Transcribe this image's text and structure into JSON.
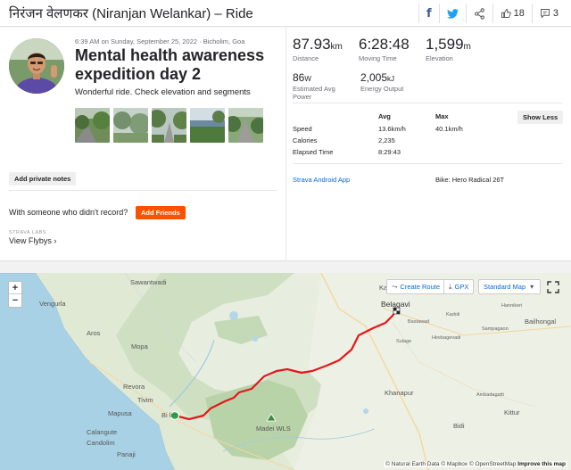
{
  "header": {
    "title": "निरंजन वेलणकर (Niranjan Welankar) – Ride",
    "kudos_count": "18",
    "comments_count": "3"
  },
  "activity": {
    "meta": "6:39 AM on Sunday, September 25, 2022 · Bicholim, Goa",
    "title": "Mental health awareness expedition day 2",
    "description": "Wonderful ride. Check elevation and segments",
    "add_notes_label": "Add private notes",
    "someone_text": "With someone who didn't record?",
    "add_friends_label": "Add Friends",
    "labs_label": "STRAVA LABS",
    "flyby_label": "View Flybys ›"
  },
  "stats": {
    "distance": {
      "value": "87.93",
      "unit": "km",
      "label": "Distance"
    },
    "moving_time": {
      "value": "6:28:48",
      "label": "Moving Time"
    },
    "elevation": {
      "value": "1,599",
      "unit": "m",
      "label": "Elevation"
    },
    "power": {
      "value": "86",
      "unit": "W",
      "label": "Estimated Avg Power"
    },
    "energy": {
      "value": "2,005",
      "unit": "kJ",
      "label": "Energy Output"
    }
  },
  "table": {
    "col_avg": "Avg",
    "col_max": "Max",
    "show_less_label": "Show Less",
    "rows": [
      {
        "label": "Speed",
        "avg": "13.6km/h",
        "max": "40.1km/h"
      },
      {
        "label": "Calories",
        "avg": "2,235",
        "max": ""
      },
      {
        "label": "Elapsed Time",
        "avg": "8:29:43",
        "max": ""
      }
    ],
    "device": "Strava Android App",
    "bike": "Bike: Hero Radical 26T"
  },
  "map": {
    "zoom_in": "+",
    "zoom_out": "−",
    "create_route": "Create Route",
    "gpx": "GPX",
    "map_type": "Standard Map",
    "labels": {
      "belagavi": "Belagavi",
      "ka": "Ka",
      "sawantwadi": "Sawantwadi",
      "vengurla": "Vengurla",
      "aros": "Aros",
      "mopa": "Mopa",
      "revora": "Revora",
      "tivim": "Tivim",
      "mapusa": "Mapusa",
      "calangute": "Calangute",
      "candolim": "Candolim",
      "panaji": "Panaji",
      "bicholim": "Bi   lim",
      "madei": "Madei WLS",
      "khanapur": "Khanapur",
      "bailhongal": "Bailhongal",
      "kittur": "Kittur",
      "bidi": "Bidi",
      "hirebagevadi": "Hirebagevadi",
      "sampagaon": "Sampagaon",
      "ambadagatti": "Ambadagatti",
      "sulage": "Sulage",
      "bastawad": "Bastawad",
      "hannikeri": "Hannikeri",
      "kadoli": "Kadoli"
    },
    "attribution_1": "© Natural Earth Data © Mapbox © OpenStreetMap",
    "attribution_2": "Improve this map",
    "route_color": "#e4161b"
  }
}
